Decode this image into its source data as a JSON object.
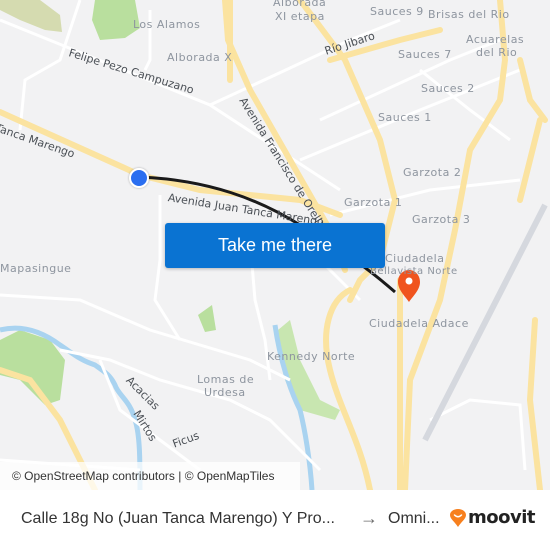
{
  "map": {
    "neighborhood_labels": [
      {
        "id": "los-alamos",
        "text": "Los Alamos"
      },
      {
        "id": "alborada-x",
        "text": "Alborada X"
      },
      {
        "id": "alborada-xi-1",
        "text": "Alborada"
      },
      {
        "id": "alborada-xi-2",
        "text": "XI etapa"
      },
      {
        "id": "sauces-9",
        "text": "Sauces 9"
      },
      {
        "id": "brisas",
        "text": "Brisas del Rio"
      },
      {
        "id": "acuarelas-1",
        "text": "Acuarelas"
      },
      {
        "id": "acuarelas-2",
        "text": "del Rio"
      },
      {
        "id": "sauces-7",
        "text": "Sauces 7"
      },
      {
        "id": "sauces-2",
        "text": "Sauces 2"
      },
      {
        "id": "sauces-1",
        "text": "Sauces 1"
      },
      {
        "id": "garzota-2",
        "text": "Garzota 2"
      },
      {
        "id": "garzota-1",
        "text": "Garzota 1"
      },
      {
        "id": "garzota-3",
        "text": "Garzota 3"
      },
      {
        "id": "ciudadela-1",
        "text": "Ciudadela"
      },
      {
        "id": "ciudadela-2",
        "text": "Bellavista Norte"
      },
      {
        "id": "adace",
        "text": "Ciudadela Adace"
      },
      {
        "id": "mapasingue",
        "text": "Mapasingue"
      },
      {
        "id": "kennedy",
        "text": "Kennedy Norte"
      },
      {
        "id": "lomas-1",
        "text": "Lomas de"
      },
      {
        "id": "lomas-2",
        "text": "Urdesa"
      }
    ],
    "street_labels": [
      {
        "id": "felipe",
        "text": "Felipe Pezo Campuzano"
      },
      {
        "id": "rio-jibaro",
        "text": "Río Jibaro"
      },
      {
        "id": "tanca-west",
        "text": "Juan Tanca Marengo"
      },
      {
        "id": "tanca-east",
        "text": "Avenida Juan Tanca Marengo"
      },
      {
        "id": "orellana",
        "text": "Avenida Francisco de Orellana"
      },
      {
        "id": "acacias",
        "text": "Acacias"
      },
      {
        "id": "mirtos",
        "text": "Mirtos"
      },
      {
        "id": "ficus",
        "text": "Ficus"
      }
    ],
    "take_me_there_label": "Take me there",
    "attribution": "© OpenStreetMap contributors | © OpenMapTiles",
    "colors": {
      "button": "#0a73d2",
      "origin_pin": "#2a6ef0",
      "destination_pin": "#f0541e",
      "route": "#1a1a1a",
      "major_road": "#fbe3a0",
      "park": "#b9df9e",
      "water": "#a9d3f0"
    }
  },
  "footer": {
    "origin": "Calle 18g No (Juan Tanca Marengo) Y Pro...",
    "arrow": "→",
    "destination": "Omni...",
    "brand": "moovit"
  }
}
